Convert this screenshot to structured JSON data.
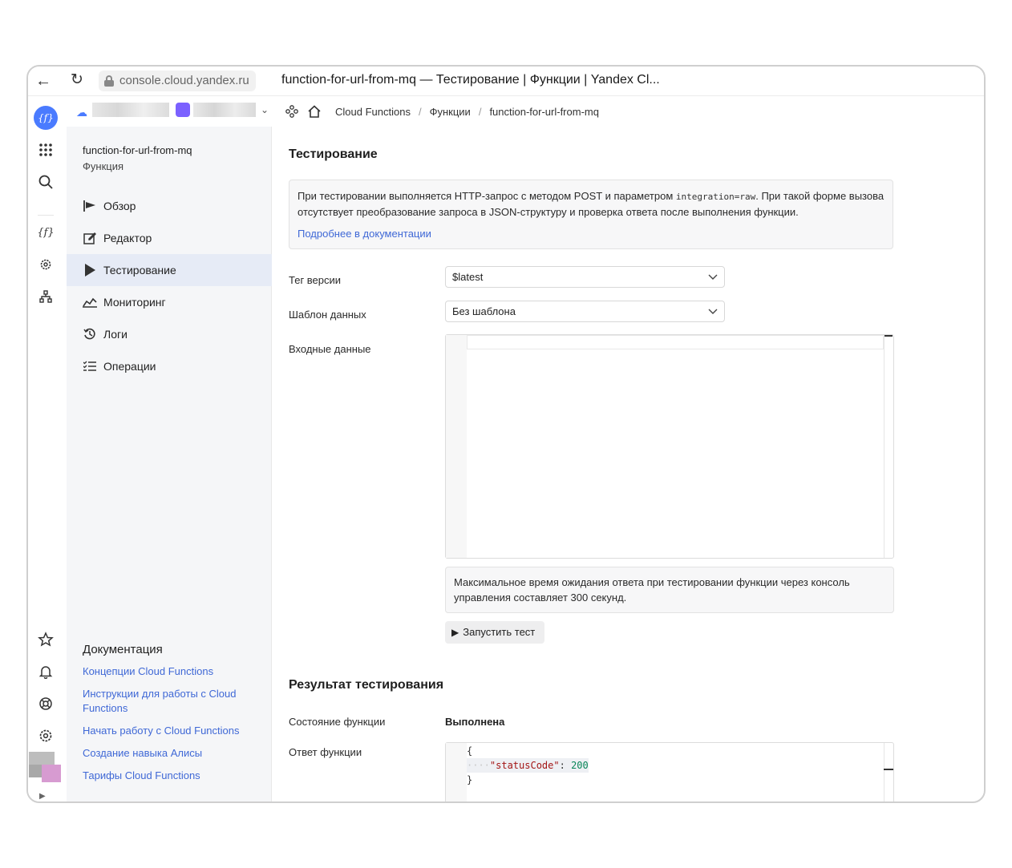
{
  "browser": {
    "url": "console.cloud.yandex.ru",
    "tab_title": "function-for-url-from-mq — Тестирование | Функции | Yandex Cl..."
  },
  "breadcrumbs": {
    "items": [
      "Cloud Functions",
      "Функции",
      "function-for-url-from-mq"
    ],
    "separator": "/"
  },
  "function": {
    "name": "function-for-url-from-mq",
    "type": "Функция"
  },
  "sidebar": {
    "items": [
      {
        "label": "Обзор",
        "icon": "overview-flag-icon"
      },
      {
        "label": "Редактор",
        "icon": "edit-icon"
      },
      {
        "label": "Тестирование",
        "icon": "play-icon"
      },
      {
        "label": "Мониторинг",
        "icon": "chart-icon"
      },
      {
        "label": "Логи",
        "icon": "history-icon"
      },
      {
        "label": "Операции",
        "icon": "list-icon"
      }
    ],
    "active_index": 2
  },
  "docs": {
    "title": "Документация",
    "links": [
      "Концепции Cloud Functions",
      "Инструкции для работы с Cloud Functions",
      "Начать работу с Cloud Functions",
      "Создание навыка Алисы",
      "Тарифы Cloud Functions"
    ]
  },
  "testing": {
    "title": "Тестирование",
    "info_text_before": "При тестировании выполняется HTTP-запрос с методом POST и параметром ",
    "info_code": "integration=raw",
    "info_text_after": ". При такой форме вызова отсутствует преобразование запроса в JSON-структуру и проверка ответа после выполнения функции.",
    "info_link": "Подробнее в документации",
    "version_tag_label": "Тег версии",
    "version_tag_value": "$latest",
    "template_label": "Шаблон данных",
    "template_value": "Без шаблона",
    "input_label": "Входные данные",
    "input_value": "",
    "timeout_note": "Максимальное время ожидания ответа при тестировании функции через консоль управления составляет 300 секунд.",
    "run_button": "Запустить тест"
  },
  "result": {
    "title": "Результат тестирования",
    "state_label": "Состояние функции",
    "state_value": "Выполнена",
    "response_label": "Ответ функции",
    "response": {
      "open": "{",
      "key": "\"statusCode\"",
      "colon": ": ",
      "value": "200",
      "close": "}"
    }
  },
  "colors": {
    "accent": "#4a7bff",
    "link": "#3f68d6",
    "folder": "#7b61ff",
    "sidebar_bg": "#f5f6f8",
    "active_bg": "#e6ebf6"
  }
}
